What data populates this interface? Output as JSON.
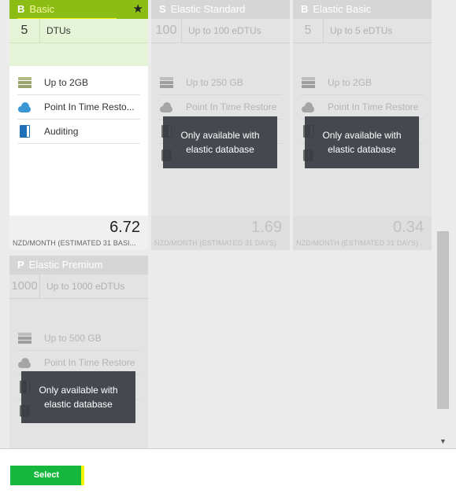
{
  "tiers": [
    {
      "letter": "B",
      "name": "Basic",
      "dtu_value": "5",
      "dtu_label": "DTUs",
      "features": [
        "Up to 2GB",
        "Point In Time Resto...",
        "Auditing"
      ],
      "price": "6.72",
      "price_label": "NZD/MONTH (ESTIMATED 31 BASI...",
      "selected": true,
      "star_icon": "star-icon"
    },
    {
      "letter": "S",
      "name": "Elastic Standard",
      "dtu_value": "100",
      "dtu_label": "Up to 100 eDTUs",
      "features": [
        "Up to 250 GB",
        "Point In Time Restore"
      ],
      "price": "1.69",
      "price_label": "NZD/MONTH (ESTIMATED 31 DAYS)",
      "overlay": "Only available with elastic database"
    },
    {
      "letter": "B",
      "name": "Elastic Basic",
      "dtu_value": "5",
      "dtu_label": "Up to 5 eDTUs",
      "features": [
        "Up to 2GB",
        "Point In Time Restore"
      ],
      "price": "0.34",
      "price_label": "NZD/MONTH (ESTIMATED 31 DAYS)",
      "overlay": "Only available with elastic database"
    },
    {
      "letter": "P",
      "name": "Elastic Premium",
      "dtu_value": "1000",
      "dtu_label": "Up to 1000 eDTUs",
      "features": [
        "Up to 500 GB",
        "Point In Time Restore"
      ],
      "overlay": "Only available with elastic database"
    }
  ],
  "footer": {
    "select_label": "Select"
  },
  "colors": {
    "accent": "#8cbd15",
    "select_button": "#15b83d",
    "highlight": "#f5f500"
  }
}
